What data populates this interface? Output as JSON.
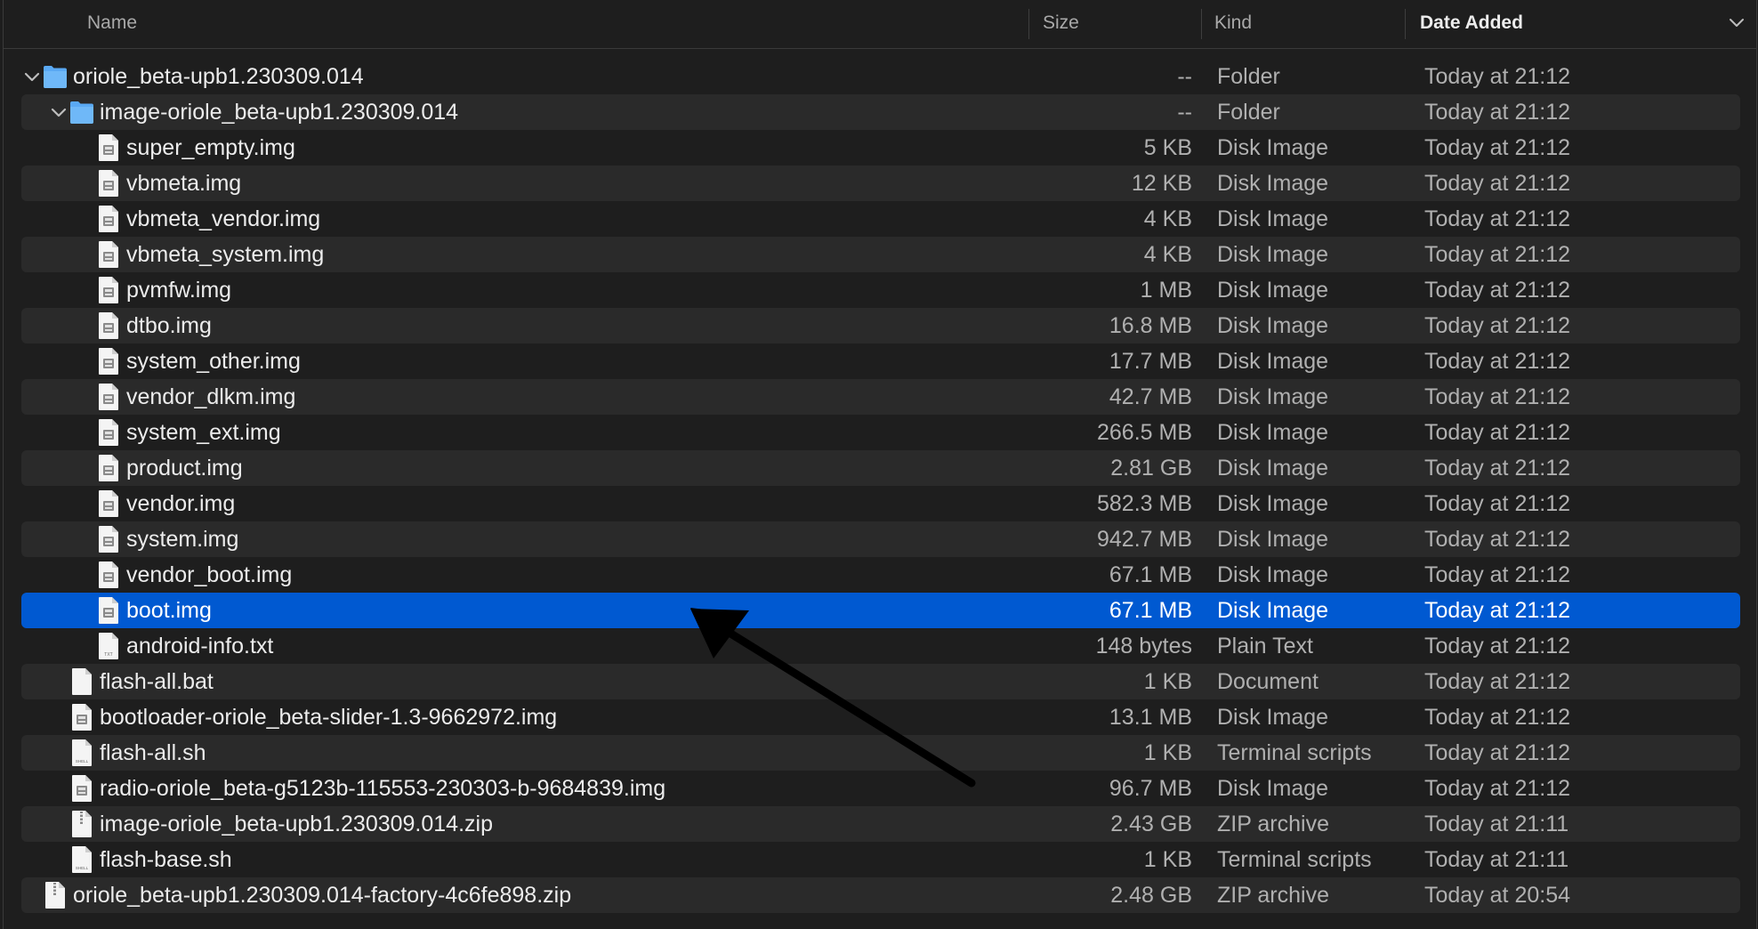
{
  "columns": {
    "name": "Name",
    "size": "Size",
    "kind": "Kind",
    "date_added": "Date Added",
    "sorted_by": "date_added"
  },
  "colors": {
    "background": "#1e1e1e",
    "alt_row": "#2a2a2a",
    "selection": "#0059d1",
    "folder": "#5aa9f4"
  },
  "rows": [
    {
      "name": "oriole_beta-upb1.230309.014",
      "size": "--",
      "kind": "Folder",
      "date": "Today at 21:12",
      "icon": "folder-icon",
      "level": 0,
      "expanded": true
    },
    {
      "name": "image-oriole_beta-upb1.230309.014",
      "size": "--",
      "kind": "Folder",
      "date": "Today at 21:12",
      "icon": "folder-icon",
      "level": 1,
      "expanded": true
    },
    {
      "name": "super_empty.img",
      "size": "5 KB",
      "kind": "Disk Image",
      "date": "Today at 21:12",
      "icon": "disk-image-icon",
      "level": 2
    },
    {
      "name": "vbmeta.img",
      "size": "12 KB",
      "kind": "Disk Image",
      "date": "Today at 21:12",
      "icon": "disk-image-icon",
      "level": 2
    },
    {
      "name": "vbmeta_vendor.img",
      "size": "4 KB",
      "kind": "Disk Image",
      "date": "Today at 21:12",
      "icon": "disk-image-icon",
      "level": 2
    },
    {
      "name": "vbmeta_system.img",
      "size": "4 KB",
      "kind": "Disk Image",
      "date": "Today at 21:12",
      "icon": "disk-image-icon",
      "level": 2
    },
    {
      "name": "pvmfw.img",
      "size": "1 MB",
      "kind": "Disk Image",
      "date": "Today at 21:12",
      "icon": "disk-image-icon",
      "level": 2
    },
    {
      "name": "dtbo.img",
      "size": "16.8 MB",
      "kind": "Disk Image",
      "date": "Today at 21:12",
      "icon": "disk-image-icon",
      "level": 2
    },
    {
      "name": "system_other.img",
      "size": "17.7 MB",
      "kind": "Disk Image",
      "date": "Today at 21:12",
      "icon": "disk-image-icon",
      "level": 2
    },
    {
      "name": "vendor_dlkm.img",
      "size": "42.7 MB",
      "kind": "Disk Image",
      "date": "Today at 21:12",
      "icon": "disk-image-icon",
      "level": 2
    },
    {
      "name": "system_ext.img",
      "size": "266.5 MB",
      "kind": "Disk Image",
      "date": "Today at 21:12",
      "icon": "disk-image-icon",
      "level": 2
    },
    {
      "name": "product.img",
      "size": "2.81 GB",
      "kind": "Disk Image",
      "date": "Today at 21:12",
      "icon": "disk-image-icon",
      "level": 2
    },
    {
      "name": "vendor.img",
      "size": "582.3 MB",
      "kind": "Disk Image",
      "date": "Today at 21:12",
      "icon": "disk-image-icon",
      "level": 2
    },
    {
      "name": "system.img",
      "size": "942.7 MB",
      "kind": "Disk Image",
      "date": "Today at 21:12",
      "icon": "disk-image-icon",
      "level": 2
    },
    {
      "name": "vendor_boot.img",
      "size": "67.1 MB",
      "kind": "Disk Image",
      "date": "Today at 21:12",
      "icon": "disk-image-icon",
      "level": 2
    },
    {
      "name": "boot.img",
      "size": "67.1 MB",
      "kind": "Disk Image",
      "date": "Today at 21:12",
      "icon": "disk-image-icon",
      "level": 2,
      "selected": true
    },
    {
      "name": "android-info.txt",
      "size": "148 bytes",
      "kind": "Plain Text",
      "date": "Today at 21:12",
      "icon": "text-file-icon",
      "level": 2
    },
    {
      "name": "flash-all.bat",
      "size": "1 KB",
      "kind": "Document",
      "date": "Today at 21:12",
      "icon": "document-icon",
      "level": 1
    },
    {
      "name": "bootloader-oriole_beta-slider-1.3-9662972.img",
      "size": "13.1 MB",
      "kind": "Disk Image",
      "date": "Today at 21:12",
      "icon": "disk-image-icon",
      "level": 1
    },
    {
      "name": "flash-all.sh",
      "size": "1 KB",
      "kind": "Terminal scripts",
      "date": "Today at 21:12",
      "icon": "shell-script-icon",
      "level": 1
    },
    {
      "name": "radio-oriole_beta-g5123b-115553-230303-b-9684839.img",
      "size": "96.7 MB",
      "kind": "Disk Image",
      "date": "Today at 21:12",
      "icon": "disk-image-icon",
      "level": 1
    },
    {
      "name": "image-oriole_beta-upb1.230309.014.zip",
      "size": "2.43 GB",
      "kind": "ZIP archive",
      "date": "Today at 21:11",
      "icon": "zip-archive-icon",
      "level": 1
    },
    {
      "name": "flash-base.sh",
      "size": "1 KB",
      "kind": "Terminal scripts",
      "date": "Today at 21:11",
      "icon": "shell-script-icon",
      "level": 1
    },
    {
      "name": "oriole_beta-upb1.230309.014-factory-4c6fe898.zip",
      "size": "2.48 GB",
      "kind": "ZIP archive",
      "date": "Today at 20:54",
      "icon": "zip-archive-icon",
      "level": 0
    }
  ]
}
